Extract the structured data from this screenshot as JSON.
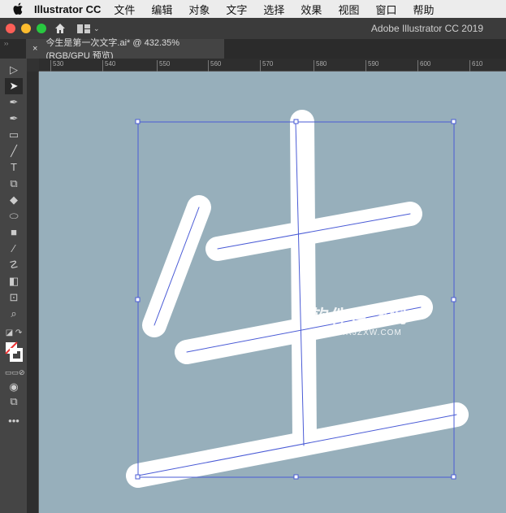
{
  "menubar": {
    "app": "Illustrator CC",
    "items": [
      "文件",
      "编辑",
      "对象",
      "文字",
      "选择",
      "效果",
      "视图",
      "窗口",
      "帮助"
    ]
  },
  "titlebar": {
    "title": "Adobe Illustrator CC 2019"
  },
  "tab": {
    "close": "×",
    "label": "今生是第一次文字.ai* @ 432.35% (RGB/GPU 预览)"
  },
  "ruler": {
    "ticks": [
      "530",
      "540",
      "550",
      "560",
      "570",
      "580",
      "590",
      "600",
      "610"
    ]
  },
  "tools": [
    "selection-tool",
    "direct-selection-tool",
    "pen-tool",
    "curvature-tool",
    "rectangle-tool",
    "paintbrush-tool",
    "type-tool",
    "scale-tool",
    "eraser-tool",
    "shape-builder-tool",
    "gradient-tool",
    "eyedropper-tool",
    "puppet-warp-tool",
    "blend-tool",
    "artboard-tool",
    "zoom-tool"
  ],
  "toolbar": {
    "more": "•••"
  },
  "watermark": {
    "cn": "软件自学网",
    "url": "WWW.RJZXW.COM"
  },
  "colors": {
    "canvas": "#97afbb",
    "selection": "#4a5bd6"
  }
}
